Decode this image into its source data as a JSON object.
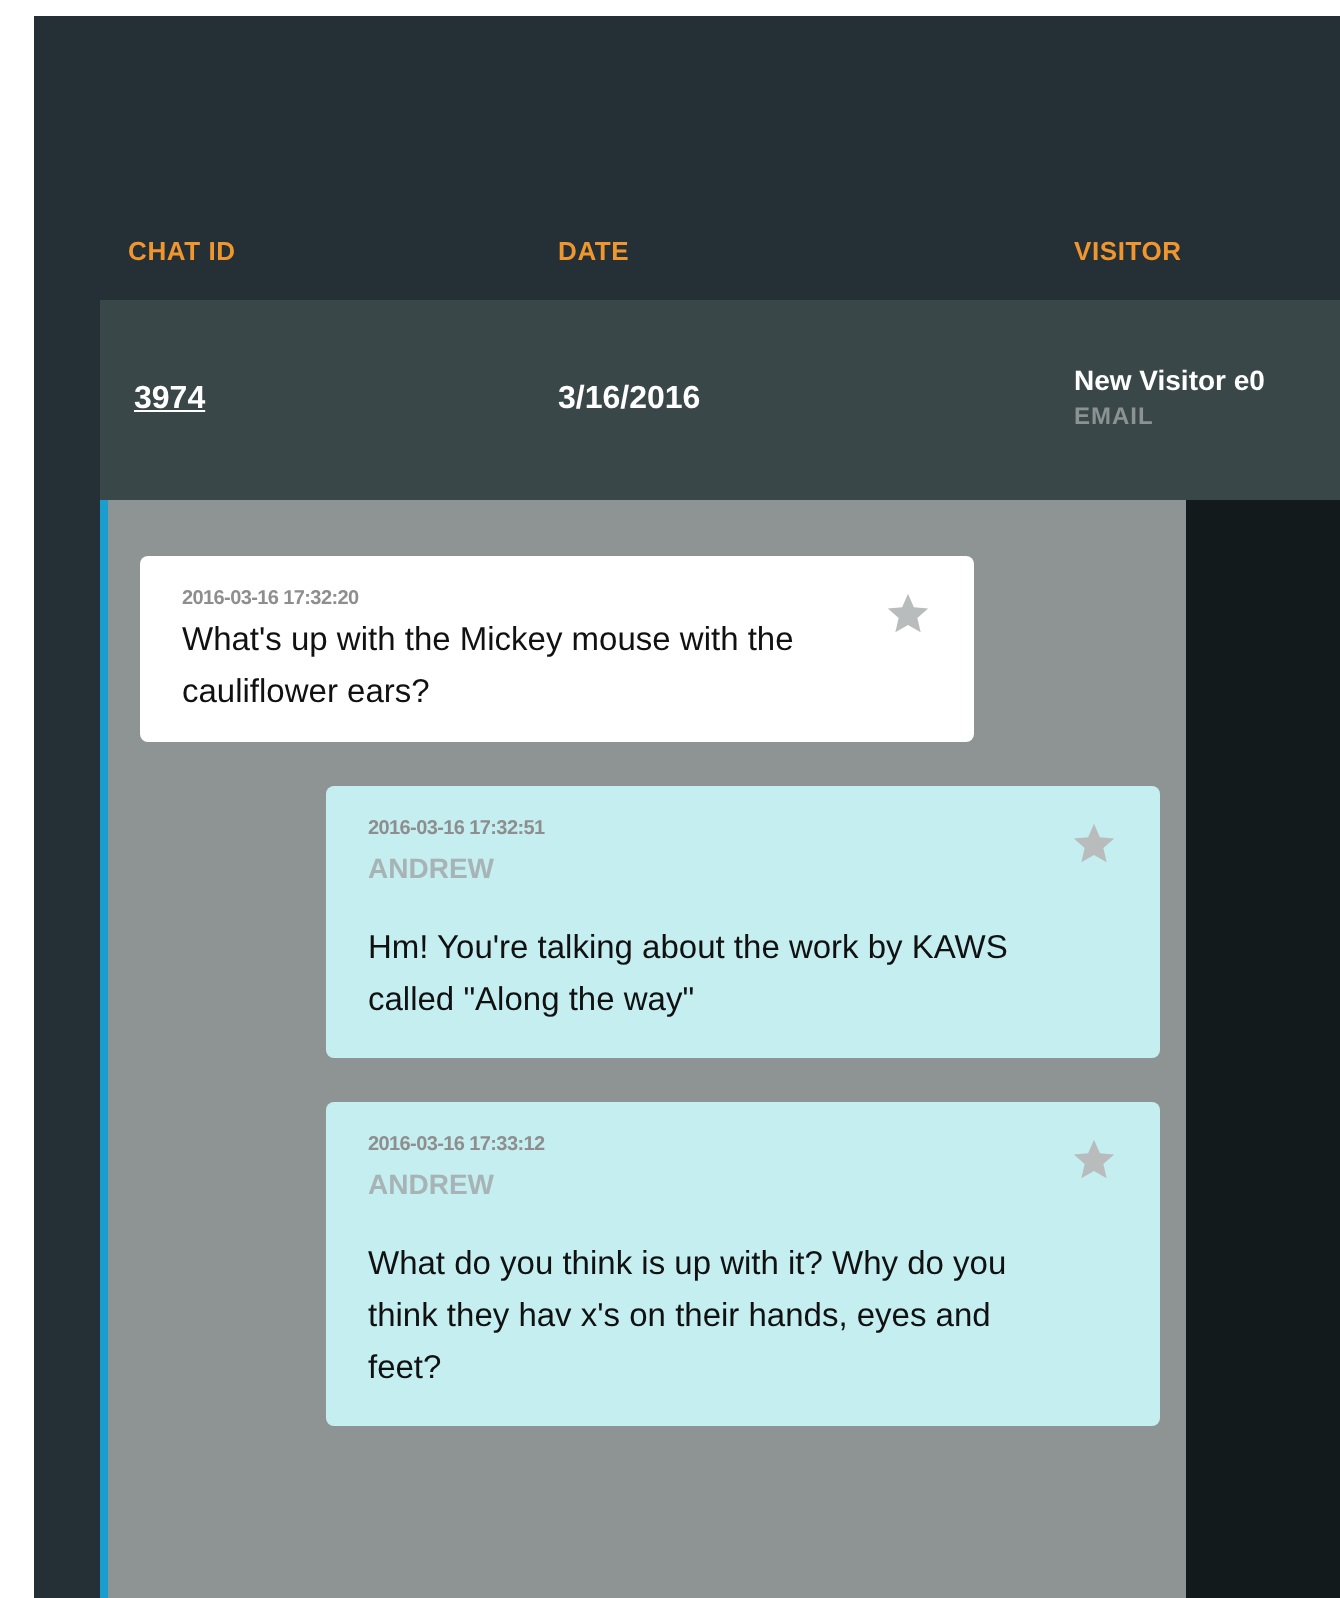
{
  "table": {
    "columns": [
      "CHAT ID",
      "DATE",
      "VISITOR"
    ],
    "rows": [
      {
        "chat_id": "3974",
        "date": "3/16/2016",
        "visitor": "New Visitor e0",
        "visitor_contact": "EMAIL",
        "expanded": true
      }
    ]
  },
  "transcript": [
    {
      "kind": "visitor",
      "time": "2016-03-16 17:32:20",
      "text": "What's up with the Mickey mouse with the cauliflower ears?",
      "starred": false
    },
    {
      "kind": "agent",
      "time": "2016-03-16 17:32:51",
      "author": "ANDREW",
      "text": "Hm! You're talking about the work by KAWS called \"Along the way\"",
      "starred": false
    },
    {
      "kind": "agent",
      "time": "2016-03-16 17:33:12",
      "author": "ANDREW",
      "text": "What do you think is up with it? Why do you think they hav x's on their hands, eyes and feet?",
      "starred": false
    }
  ]
}
